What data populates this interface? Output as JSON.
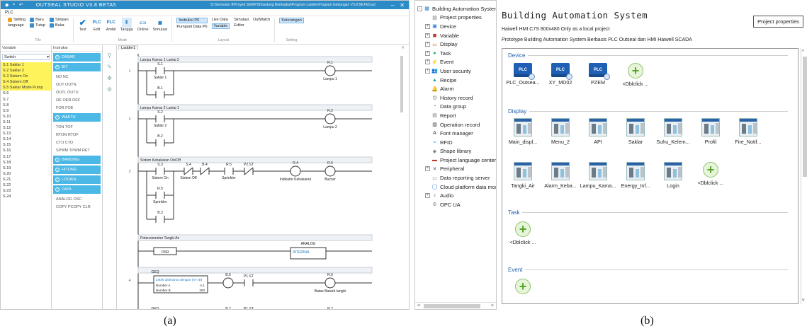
{
  "panel_a": {
    "title": "OUTSEAL STUDIO V3.8 BETA5",
    "path": "D:\\Semester 8\\Proyek SKRIPSI\\Gedung Bertingkat\\Program Ladder\\Program Gedungan V3.8 BETA5.lad",
    "menu": "PLC",
    "ribbon": {
      "file": {
        "label": "File",
        "setting": "Setting",
        "language": "language",
        "baru": "Baru",
        "simpan": "Simpan",
        "tutup": "Tutup",
        "buka": "Buka"
      },
      "mode": {
        "label": "Mode",
        "test": "Test",
        "edit": "Edit",
        "ambil": "Ambil",
        "tangga": "Tangga",
        "online": "Online",
        "simulasi": "Simulasi"
      },
      "layout": {
        "label": "Layout",
        "instruksi": "Instruksi P6",
        "live_data": "Live Data",
        "simulasi": "Simulasi",
        "outwatch": "OutWatch",
        "pumpset": "Pumpset Data P6",
        "variable": "Variable",
        "editor": "Editor"
      },
      "setting": {
        "label": "Setting",
        "keterangan": "Keterangan"
      }
    },
    "variable_panel": {
      "header": "Variable",
      "combo": "Switch",
      "items": [
        {
          "text": "S.1 Saklar 1",
          "highlight": true
        },
        {
          "text": "S.2 Saklar 2",
          "highlight": true
        },
        {
          "text": "S.3 Sistem On",
          "highlight": true
        },
        {
          "text": "S.4 Sistem Off",
          "highlight": true
        },
        {
          "text": "S.5 Saklar Mode Pump",
          "highlight": true
        },
        {
          "text": "S.6",
          "highlight": false
        },
        {
          "text": "S.7",
          "highlight": false
        },
        {
          "text": "S.8",
          "highlight": false
        },
        {
          "text": "S.9",
          "highlight": false
        },
        {
          "text": "S.10",
          "highlight": false
        },
        {
          "text": "S.11",
          "highlight": false
        },
        {
          "text": "S.12",
          "highlight": false
        },
        {
          "text": "S.13",
          "highlight": false
        },
        {
          "text": "S.14",
          "highlight": false
        },
        {
          "text": "S.15",
          "highlight": false
        },
        {
          "text": "S.16",
          "highlight": false
        },
        {
          "text": "S.17",
          "highlight": false
        },
        {
          "text": "S.18",
          "highlight": false
        },
        {
          "text": "S.19",
          "highlight": false
        },
        {
          "text": "S.20",
          "highlight": false
        },
        {
          "text": "S.21",
          "highlight": false
        },
        {
          "text": "S.22",
          "highlight": false
        },
        {
          "text": "S.23",
          "highlight": false
        },
        {
          "text": "S.24",
          "highlight": false
        }
      ]
    },
    "instruction_panel": {
      "header": "Instruksi",
      "blocks": [
        {
          "cat": "DASAR",
          "subs": []
        },
        {
          "cat": "BIT",
          "subs": [
            "NO NC",
            "OUT OUTN",
            "OUTL OUTU",
            "OE OER OEF",
            "FOR FOE"
          ]
        },
        {
          "cat": "WAKTU",
          "subs": [
            "TON TOF",
            "RTON RTOF",
            "CTU CTD",
            "SPWM TPWM RET"
          ]
        },
        {
          "cat": "BANDING",
          "subs": []
        },
        {
          "cat": "HITUNG",
          "subs": []
        },
        {
          "cat": "LOGIKA",
          "subs": []
        },
        {
          "cat": "DATA",
          "subs": [
            "ANALOG OSC",
            "COPY PCOPY CLR"
          ]
        }
      ]
    },
    "ladder": {
      "tab": "Ladder1",
      "rungs": [
        {
          "num": "1",
          "comment": "Lampu Kamar 1 Lantai 2",
          "contacts": [
            {
              "tag": "S.1",
              "name": "Saklar 1"
            },
            {
              "tag": "B.1",
              "name": ""
            }
          ],
          "coil": {
            "tag": "R.1",
            "name": "Lampu 1"
          }
        },
        {
          "num": "2",
          "comment": "Lampu Kamar 2 Lantai 1",
          "contacts": [
            {
              "tag": "S.2",
              "name": "Saklar 2"
            },
            {
              "tag": "B.2",
              "name": ""
            }
          ],
          "coil": {
            "tag": "R.2",
            "name": "Lampu 2"
          }
        },
        {
          "num": "3",
          "comment": "Sistem Kebakaran On/Off",
          "c1": {
            "tag": "S.3",
            "name": "Sistem On"
          },
          "c1b": {
            "tag": "R.5",
            "name": ""
          },
          "c1c": {
            "tag": "R.5",
            "name": "Sprinkler"
          },
          "c1d": {
            "tag": "B.3",
            "name": ""
          },
          "c2": {
            "tag": "S.4",
            "name": "Sistem Off"
          },
          "c3": {
            "tag": "B.4",
            "name": ""
          },
          "c4": {
            "tag": "R.5",
            "name": "Sprinkler"
          },
          "c5": {
            "tag": "P2.ST",
            "name": ""
          },
          "coil1": {
            "tag": "R.4",
            "name": "Indikator Kebakaran"
          },
          "coil2": {
            "tag": "R.5",
            "name": "Buzzer"
          }
        },
        {
          "num": "",
          "comment": "Potensiometer Tangki Air",
          "osr": "OSR",
          "analog_title": "ANALOG",
          "analog_sub": "INTERNAL"
        },
        {
          "num": "4",
          "comment": "",
          "geq_a": "GEQ",
          "geq_text": "Lebih dari/sama dengan (A>=B)",
          "num_a": "Number A",
          "num_b": "Number B",
          "val_a": "A.1",
          "val_b": "200",
          "c1": {
            "tag": "B.6",
            "name": ""
          },
          "c2": {
            "tag": "P1.ST",
            "name": ""
          },
          "coil": {
            "tag": "R.6",
            "name": "Batas Bawah tangki"
          },
          "next_geq": "GEQ",
          "next_c1": "B.7",
          "next_c2": "P1.ST",
          "next_coil": "R.7"
        }
      ]
    }
  },
  "panel_b": {
    "tree": [
      {
        "label": "Building Automation System",
        "toggle": "-",
        "level": 0,
        "icon": "project"
      },
      {
        "label": "Project properties",
        "toggle": "",
        "level": 1,
        "icon": "doc"
      },
      {
        "label": "Device",
        "toggle": "+",
        "level": 1,
        "icon": "device"
      },
      {
        "label": "Variable",
        "toggle": "+",
        "level": 1,
        "icon": "variable"
      },
      {
        "label": "Display",
        "toggle": "+",
        "level": 1,
        "icon": "display"
      },
      {
        "label": "Task",
        "toggle": "+",
        "level": 1,
        "icon": "task"
      },
      {
        "label": "Event",
        "toggle": "+",
        "level": 1,
        "icon": "event"
      },
      {
        "label": "User security",
        "toggle": "+",
        "level": 1,
        "icon": "users"
      },
      {
        "label": "Recipe",
        "toggle": "",
        "level": 1,
        "icon": "recipe"
      },
      {
        "label": "Alarm",
        "toggle": "",
        "level": 1,
        "icon": "alarm"
      },
      {
        "label": "History record",
        "toggle": "",
        "level": 1,
        "icon": "history"
      },
      {
        "label": "Data group",
        "toggle": "",
        "level": 1,
        "icon": "datagroup"
      },
      {
        "label": "Report",
        "toggle": "",
        "level": 1,
        "icon": "report"
      },
      {
        "label": "Operation record",
        "toggle": "",
        "level": 1,
        "icon": "oprecord"
      },
      {
        "label": "Font manager",
        "toggle": "",
        "level": 1,
        "icon": "font"
      },
      {
        "label": "RFID",
        "toggle": "",
        "level": 1,
        "icon": "rfid"
      },
      {
        "label": "Shape library",
        "toggle": "",
        "level": 1,
        "icon": "shape"
      },
      {
        "label": "Project language center",
        "toggle": "",
        "level": 1,
        "icon": "language"
      },
      {
        "label": "Peripheral",
        "toggle": "+",
        "level": 1,
        "icon": "peripheral"
      },
      {
        "label": "Data reporting server",
        "toggle": "",
        "level": 1,
        "icon": "server"
      },
      {
        "label": "Cloud platform data monito",
        "toggle": "",
        "level": 1,
        "icon": "cloud"
      },
      {
        "label": "Audio",
        "toggle": "+",
        "level": 1,
        "icon": "audio"
      },
      {
        "label": "OPC UA",
        "toggle": "",
        "level": 1,
        "icon": "opc"
      }
    ],
    "main": {
      "title": "Building Automation System",
      "device_line": "Haiwell HMI C7S  800x480  Only as a local project",
      "description": "Prototype Building Automation System Berbasis PLC Outseal dan HMI Haiwell SCADA",
      "project_button": "Project properties",
      "sections": {
        "device": {
          "label": "Device",
          "items": [
            {
              "label": "PLC_Outsea...",
              "type": "plc"
            },
            {
              "label": "XY_MD02",
              "type": "plc"
            },
            {
              "label": "PZEM",
              "type": "plc"
            },
            {
              "label": "<Dblclick ...",
              "type": "add"
            }
          ]
        },
        "display": {
          "label": "Display",
          "items": [
            {
              "label": "Main_displ...",
              "type": "thumb"
            },
            {
              "label": "Menu_2",
              "type": "thumb"
            },
            {
              "label": "API",
              "type": "thumb"
            },
            {
              "label": "Saklar",
              "type": "thumb"
            },
            {
              "label": "Suhu_Kelem...",
              "type": "thumb"
            },
            {
              "label": "Profil",
              "type": "thumb"
            },
            {
              "label": "Fire_Notif...",
              "type": "thumb"
            },
            {
              "label": "Tangki_Air",
              "type": "thumb"
            },
            {
              "label": "Alarm_Keba...",
              "type": "thumb"
            },
            {
              "label": "Lampu_Kama...",
              "type": "thumb"
            },
            {
              "label": "Energy_Inf...",
              "type": "thumb"
            },
            {
              "label": "Login",
              "type": "thumb"
            },
            {
              "label": "<Dblclick ...",
              "type": "add"
            }
          ]
        },
        "task": {
          "label": "Task",
          "items": [
            {
              "label": "<Dblclick ...",
              "type": "add"
            }
          ]
        },
        "event": {
          "label": "Event",
          "items": [
            {
              "label": "",
              "type": "add"
            }
          ]
        }
      }
    }
  },
  "captions": {
    "a": "(a)",
    "b": "(b)"
  },
  "colors": {
    "titlebar": "#2b8bc6",
    "category": "#4bb8e6",
    "highlight": "#fff35c",
    "section": "#2361a8"
  }
}
